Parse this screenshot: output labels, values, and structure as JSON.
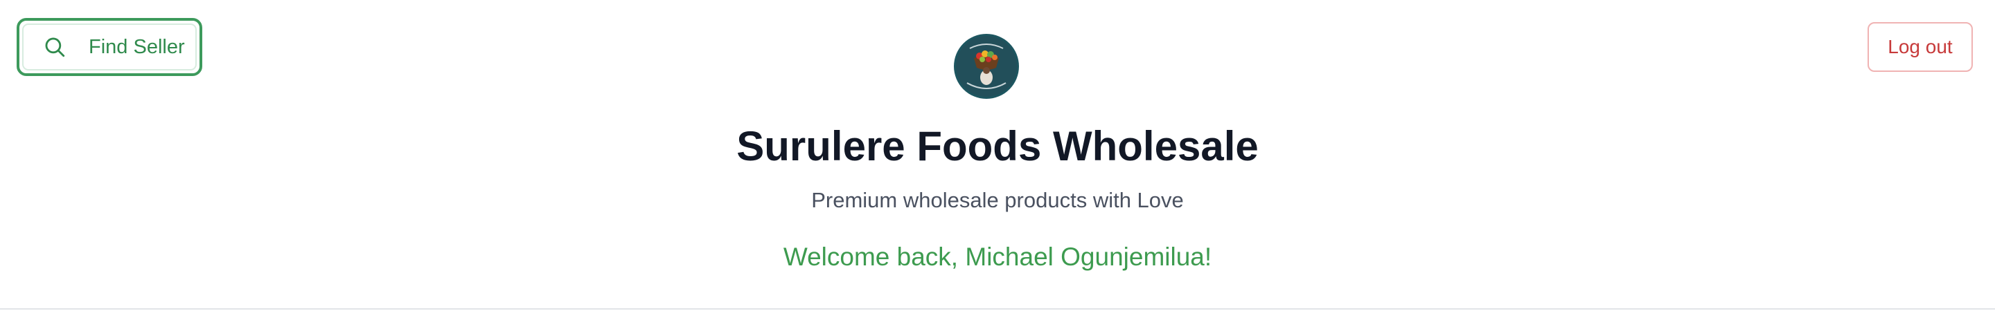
{
  "header": {
    "find_seller_label": "Find Seller",
    "logout_label": "Log out",
    "title": "Surulere Foods Wholesale",
    "subtitle": "Premium wholesale products with Love",
    "welcome": "Welcome back, Michael Ogunjemilua!"
  },
  "icons": {
    "find_seller_icon": "search-icon",
    "logo": "surulere-foods-logo"
  },
  "colors": {
    "accent_green": "#3d9a5c",
    "welcome_green": "#3d9b4f",
    "logout_red": "#c73a3a",
    "title_dark": "#121826"
  }
}
